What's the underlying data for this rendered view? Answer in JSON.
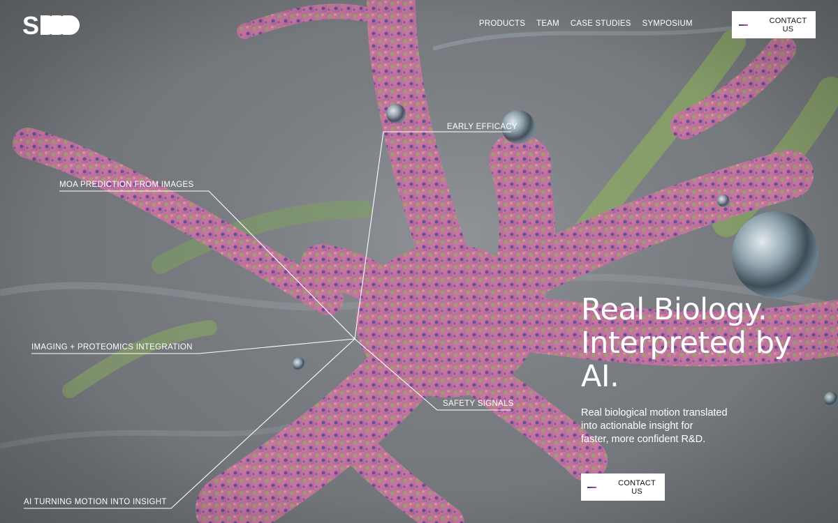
{
  "brand": {
    "logo_letter": "S"
  },
  "nav": {
    "items": [
      {
        "label": "PRODUCTS"
      },
      {
        "label": "TEAM"
      },
      {
        "label": "CASE STUDIES"
      },
      {
        "label": "SYMPOSIUM"
      }
    ],
    "cta_label": "CONTACT US"
  },
  "annotations": {
    "early_efficacy": "EARLY EFFICACY",
    "moa_prediction": "MOA PREDICTION FROM IMAGES",
    "imaging_proteomics": "IMAGING + PROTEOMICS INTEGRATION",
    "safety_signals": "SAFETY SIGNALS",
    "ai_motion": "AI TURNING MOTION INTO INSIGHT"
  },
  "hero": {
    "headline_lines": [
      "Real Biology.",
      "Interpreted by",
      "AI."
    ],
    "sub_lines": [
      "Real biological motion translated",
      "into actionable insight for",
      "faster, more confident R&D."
    ],
    "cta_label": "CONTACT US"
  },
  "colors": {
    "background": "#7a7e82",
    "cell_pink": "#c9739a",
    "cell_green": "#8fb35a",
    "cell_purple": "#4a3f8c",
    "text": "#ffffff",
    "button_bg": "#ffffff",
    "accent_gradient_start": "#3c2a8c",
    "accent_gradient_end": "#c94fa8"
  },
  "icons": {
    "logo": "s-logo-icon",
    "cta_dash": "gradient-dash-icon"
  }
}
